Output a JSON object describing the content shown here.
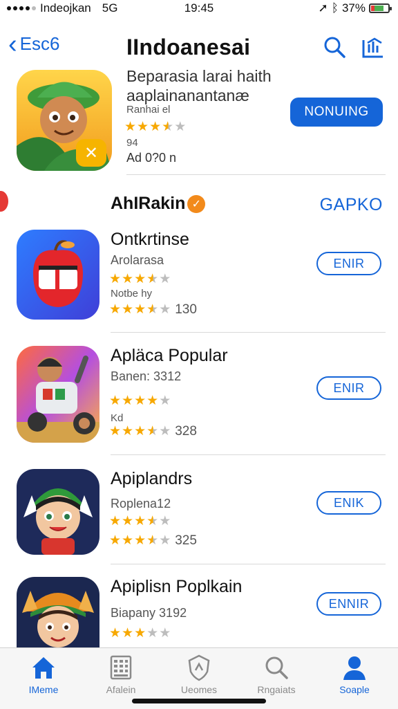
{
  "status_bar": {
    "carrier": "Indeojkan",
    "network": "5G",
    "time": "19:45",
    "battery_pct": "37%"
  },
  "nav": {
    "back_label": "Esc6",
    "title": "IIndoanesai",
    "icons": [
      "search-icon",
      "share-icon"
    ]
  },
  "featured": {
    "title": "Beparasia larai haith aaplainanantanæ",
    "subtitle": "Ranhai el",
    "rating": 3.5,
    "size": "94",
    "price": "Ad 0?0 n",
    "button_label": "NONUING"
  },
  "section": {
    "title": "AhIRakin",
    "see_all": "GAPKO"
  },
  "apps": [
    {
      "name": "Ontkrtinse",
      "subtitle": "Arolarasa",
      "rating1": 3.5,
      "meta": "Notbe hy",
      "rating2": 3.5,
      "count": "130",
      "button": "ENIR"
    },
    {
      "name": "Apläca Popular",
      "subtitle": "Banen: 3312",
      "rating1": 4,
      "meta": "Kd",
      "rating2": 3.5,
      "count": "328",
      "button": "ENIR"
    },
    {
      "name": "Apiplandrs",
      "subtitle": "Roplena12",
      "rating1": 3.5,
      "meta": "",
      "rating2": 3.5,
      "count": "325",
      "button": "ENIK"
    },
    {
      "name": "Apiplisn Poplkain",
      "subtitle": "Biapany 3192",
      "rating1": 3,
      "meta": "",
      "rating2": null,
      "count": "",
      "button": "ENNIR"
    }
  ],
  "tabs": [
    {
      "label": "IMeme",
      "icon": "home-icon",
      "active": true
    },
    {
      "label": "Afalein",
      "icon": "apps-grid-icon",
      "active": false
    },
    {
      "label": "Ueomes",
      "icon": "games-shield-icon",
      "active": false
    },
    {
      "label": "Rngaiats",
      "icon": "search-icon",
      "active": false
    },
    {
      "label": "Soaple",
      "icon": "profile-icon",
      "active": true
    }
  ],
  "colors": {
    "accent": "#1565d8",
    "star": "#f7a800",
    "star_off": "#bdbdbd"
  }
}
